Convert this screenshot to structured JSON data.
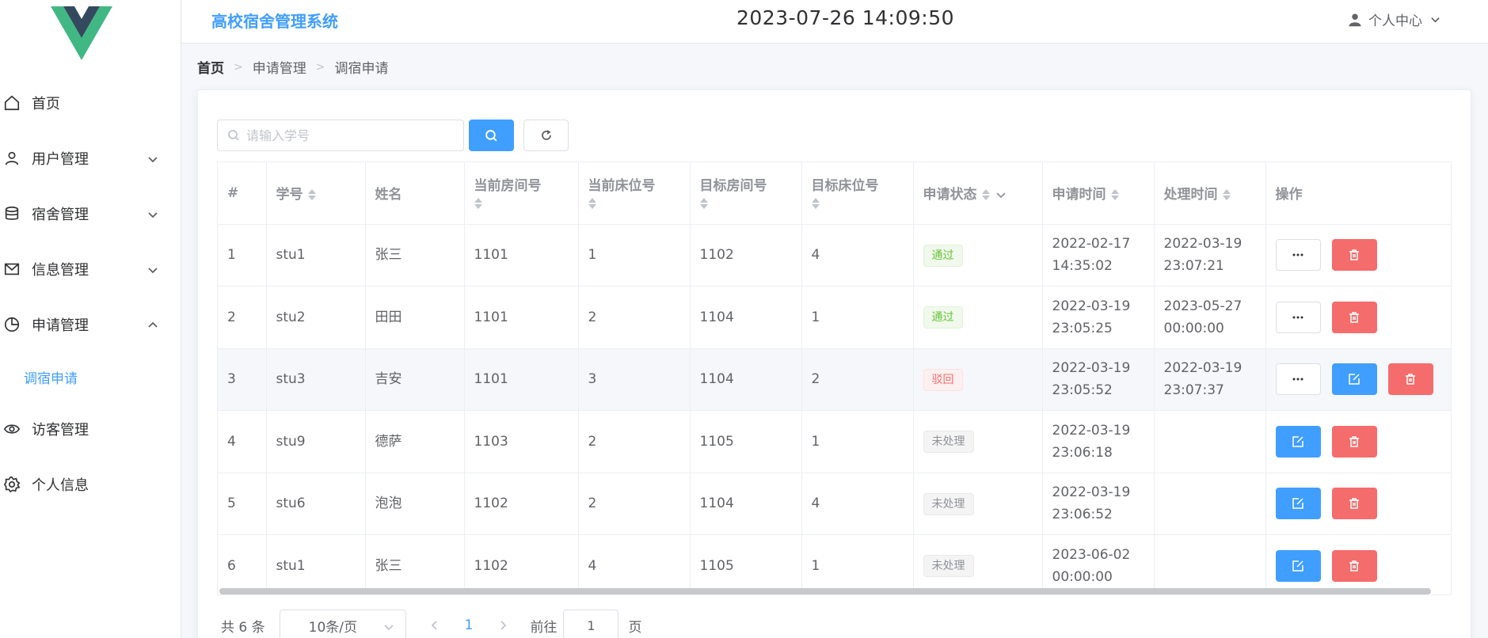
{
  "sidebar": {
    "items": [
      {
        "label": "首页",
        "icon": "home-icon"
      },
      {
        "label": "用户管理",
        "icon": "user-icon"
      },
      {
        "label": "宿舍管理",
        "icon": "database-icon"
      },
      {
        "label": "信息管理",
        "icon": "mail-icon"
      },
      {
        "label": "申请管理",
        "icon": "pie-chart-icon"
      },
      {
        "label": "访客管理",
        "icon": "eye-icon"
      },
      {
        "label": "个人信息",
        "icon": "gear-icon"
      }
    ],
    "sub_items": [
      {
        "label": "调宿申请"
      }
    ]
  },
  "header": {
    "title": "高校宿舍管理系统",
    "clock": "2023-07-26 14:09:50",
    "user_menu": "个人中心"
  },
  "breadcrumb": [
    "首页",
    "申请管理",
    "调宿申请"
  ],
  "search": {
    "placeholder": "请输入学号",
    "value": ""
  },
  "table": {
    "columns": [
      "#",
      "学号",
      "姓名",
      "当前房间号",
      "当前床位号",
      "目标房间号",
      "目标床位号",
      "申请状态",
      "申请时间",
      "处理时间",
      "操作"
    ],
    "rows": [
      {
        "idx": "1",
        "sid": "stu1",
        "name": "张三",
        "cur_room": "1101",
        "cur_bed": "1",
        "tgt_room": "1102",
        "tgt_bed": "4",
        "status": "通过",
        "apply_time": "2022-02-17 14:35:02",
        "handle_time": "2022-03-19 23:07:21"
      },
      {
        "idx": "2",
        "sid": "stu2",
        "name": "田田",
        "cur_room": "1101",
        "cur_bed": "2",
        "tgt_room": "1104",
        "tgt_bed": "1",
        "status": "通过",
        "apply_time": "2022-03-19 23:05:25",
        "handle_time": "2023-05-27 00:00:00"
      },
      {
        "idx": "3",
        "sid": "stu3",
        "name": "吉安",
        "cur_room": "1101",
        "cur_bed": "3",
        "tgt_room": "1104",
        "tgt_bed": "2",
        "status": "驳回",
        "apply_time": "2022-03-19 23:05:52",
        "handle_time": "2022-03-19 23:07:37"
      },
      {
        "idx": "4",
        "sid": "stu9",
        "name": "德萨",
        "cur_room": "1103",
        "cur_bed": "2",
        "tgt_room": "1105",
        "tgt_bed": "1",
        "status": "未处理",
        "apply_time": "2022-03-19 23:06:18",
        "handle_time": ""
      },
      {
        "idx": "5",
        "sid": "stu6",
        "name": "泡泡",
        "cur_room": "1102",
        "cur_bed": "2",
        "tgt_room": "1104",
        "tgt_bed": "4",
        "status": "未处理",
        "apply_time": "2022-03-19 23:06:52",
        "handle_time": ""
      },
      {
        "idx": "6",
        "sid": "stu1",
        "name": "张三",
        "cur_room": "1102",
        "cur_bed": "4",
        "tgt_room": "1105",
        "tgt_bed": "1",
        "status": "未处理",
        "apply_time": "2023-06-02 00:00:00",
        "handle_time": ""
      }
    ]
  },
  "pagination": {
    "total_text": "共 6 条",
    "page_size": "10条/页",
    "current_page": "1",
    "goto_prefix": "前往",
    "goto_value": "1",
    "goto_suffix": "页"
  },
  "colors": {
    "primary": "#409eff",
    "danger": "#f56c6c",
    "success": "#67c23a",
    "info": "#909399"
  }
}
